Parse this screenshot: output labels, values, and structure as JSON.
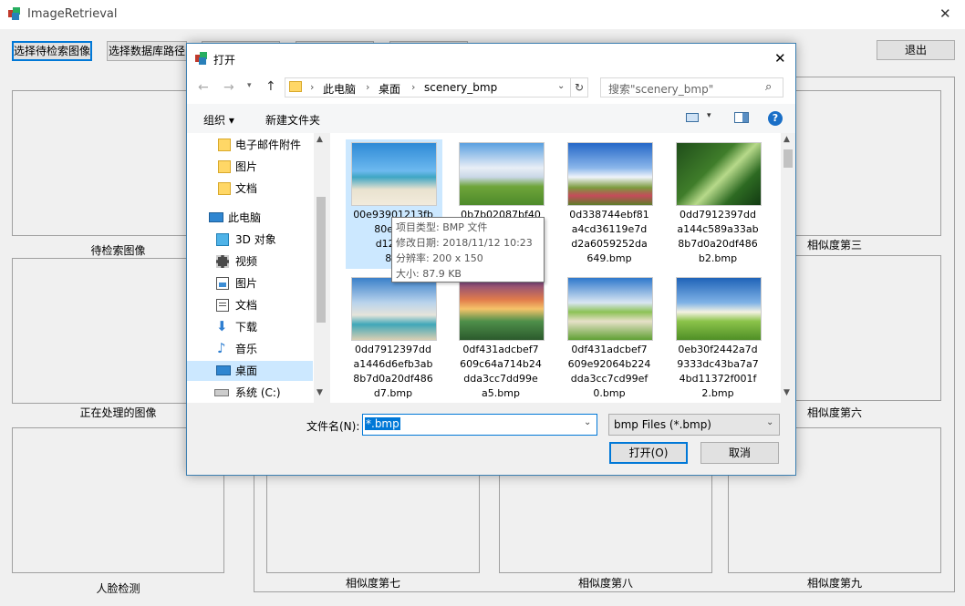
{
  "app": {
    "title": "ImageRetrieval",
    "close_glyph": "✕"
  },
  "toolbar": {
    "select_query_label": "选择待检索图像",
    "select_db_label": "选择数据库路径",
    "exit_label": "退出"
  },
  "panels": {
    "query": "待检索图像",
    "processing": "正在处理的图像",
    "face": "人脸检测",
    "sim3": "相似度第三",
    "sim6": "相似度第六",
    "sim7": "相似度第七",
    "sim8": "相似度第八",
    "sim9": "相似度第九"
  },
  "dialog": {
    "title": "打开",
    "breadcrumb": [
      "此电脑",
      "桌面",
      "scenery_bmp"
    ],
    "search_placeholder": "搜索\"scenery_bmp\"",
    "organize_label": "组织 ▾",
    "new_folder_label": "新建文件夹",
    "nav_items": [
      {
        "label": "电子邮件附件",
        "icon": "folder-icon"
      },
      {
        "label": "图片",
        "icon": "folder-icon"
      },
      {
        "label": "文档",
        "icon": "folder-icon"
      },
      {
        "label": "此电脑",
        "icon": "computer-icon"
      },
      {
        "label": "3D 对象",
        "icon": "3d-objects-icon"
      },
      {
        "label": "视频",
        "icon": "video-icon"
      },
      {
        "label": "图片",
        "icon": "pictures-icon"
      },
      {
        "label": "文档",
        "icon": "documents-icon"
      },
      {
        "label": "下载",
        "icon": "download-icon"
      },
      {
        "label": "音乐",
        "icon": "music-icon"
      },
      {
        "label": "桌面",
        "icon": "desktop-icon"
      },
      {
        "label": "系统 (C:)",
        "icon": "drive-icon"
      }
    ],
    "files": [
      {
        "name": "00e93901213fb80ebe9d12f2e8.bmp",
        "lines": [
          "00e93901213fb",
          "80ebe9",
          "d12f2e",
          "8.b"
        ]
      },
      {
        "name": "0b7b02087bf40",
        "lines": [
          "0b7b02087bf40"
        ]
      },
      {
        "name": "0d338744ebf81a4cd36119e7dd2a6059252da649.bmp",
        "lines": [
          "0d338744ebf81",
          "a4cd36119e7d",
          "d2a6059252da",
          "649.bmp"
        ]
      },
      {
        "name": "0dd7912397dda144c589a33ab8b7d0a20df486b2.bmp",
        "lines": [
          "0dd7912397dd",
          "a144c589a33ab",
          "8b7d0a20df486",
          "b2.bmp"
        ]
      },
      {
        "name": "0dd7912397dda1446d6efb3ab8b7d0a20df486d7.bmp",
        "lines": [
          "0dd7912397dd",
          "a1446d6efb3ab",
          "8b7d0a20df486",
          "d7.bmp"
        ]
      },
      {
        "name": "0df431adcbef7609c64a714b24dda3cc7dd99ea5.bmp",
        "lines": [
          "0df431adcbef7",
          "609c64a714b24",
          "dda3cc7dd99e",
          "a5.bmp"
        ]
      },
      {
        "name": "0df431adcbef7609e92064b224dda3cc7cd99ef0.bmp",
        "lines": [
          "0df431adcbef7",
          "609e92064b224",
          "dda3cc7cd99ef",
          "0.bmp"
        ]
      },
      {
        "name": "0eb30f2442a7d9333dc43ba7a74bd11372f001f2.bmp",
        "lines": [
          "0eb30f2442a7d",
          "9333dc43ba7a7",
          "4bd11372f001f",
          "2.bmp"
        ]
      }
    ],
    "tooltip": {
      "type": "项目类型: BMP 文件",
      "date": "修改日期: 2018/11/12 10:23",
      "dims": "分辨率: 200 x 150",
      "size": "大小: 87.9 KB"
    },
    "filename_label": "文件名(N):",
    "filename_value": "*.bmp",
    "filter_value": "bmp Files (*.bmp)",
    "open_label": "打开(O)",
    "cancel_label": "取消"
  },
  "colors": {
    "accent": "#0078d7",
    "dialog_border": "#3c7fb1",
    "selection": "#cce8ff",
    "help": "#1a6fc7"
  }
}
